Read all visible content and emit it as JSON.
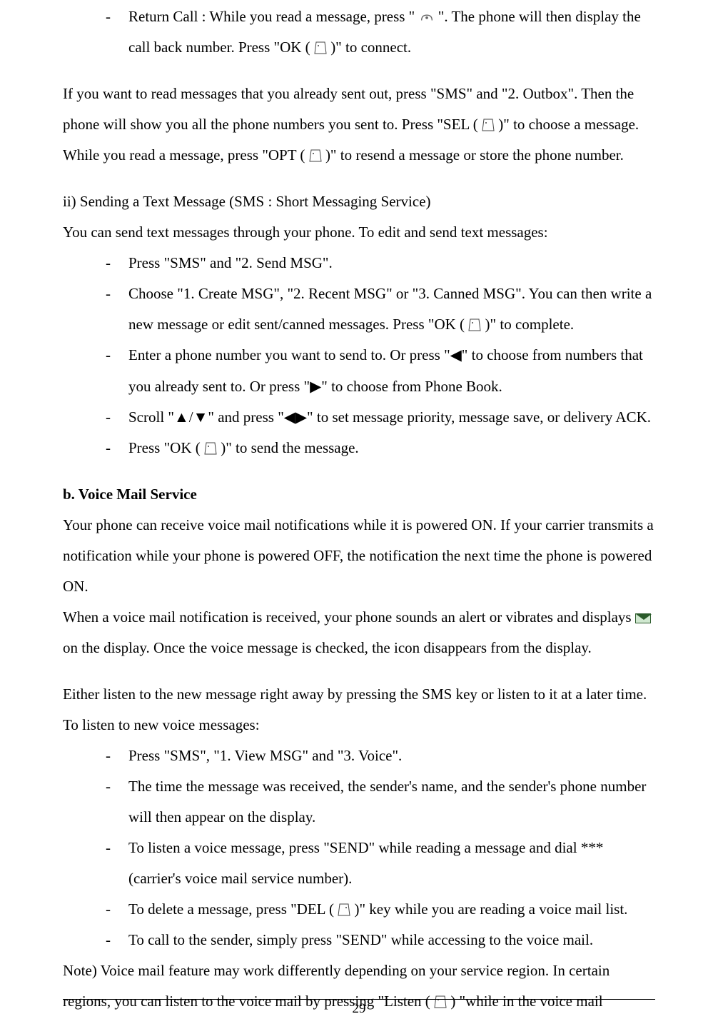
{
  "top_bullet": {
    "pre": "Return Call : While you read a message, press \" ",
    "post_icon1": " \". The phone will then display the ",
    "line2_pre": "call back number. Press \"OK (",
    "line2_post": ")\" to connect."
  },
  "outbox_para": {
    "l1_pre": "If you want to read messages that you already sent out, press \"SMS\" and \"2. Outbox\". Then the ",
    "l2_pre": "phone will show you all the phone numbers you sent to. Press \"SEL (",
    "l2_post": ")\" to choose a message. ",
    "l3_pre": "While you read a message, press \"OPT (",
    "l3_post": ")\" to resend a message or store the phone number."
  },
  "section_ii": {
    "title": "ii)   Sending a Text Message (SMS : Short Messaging Service)",
    "intro": "You can send text messages through your phone.    To edit and send text messages:",
    "b1": "Press \"SMS\" and \"2. Send MSG\".",
    "b2_l1": "Choose \"1. Create MSG\", \"2. Recent MSG\" or \"3. Canned MSG\". You can then write a ",
    "b2_l2_pre": "new message or edit sent/canned messages. Press \"OK (",
    "b2_l2_post": ")\" to complete.",
    "b3_l1": "Enter a phone number you want to send to. Or press \"◀\" to choose from numbers that ",
    "b3_l2": "you already sent to. Or press \"▶\" to choose from Phone Book.",
    "b4_l1": "Scroll \"▲/▼\" and press \"◀▶\" to set message priority, message save, or delivery ",
    "b4_l2": "ACK.",
    "b5_pre": "Press \"OK (",
    "b5_post": ")\" to send the message."
  },
  "voice_mail": {
    "heading": "b. Voice Mail Service",
    "p1_l1": "Your phone can receive voice mail notifications while it is powered ON.    If your carrier ",
    "p1_l2": "transmits a notification while your phone is powered OFF, the notification the next time the ",
    "p1_l3": "phone is powered ON.",
    "p2_l1": "When a voice mail notification is received, your phone sounds an alert or vibrates and displays ",
    "p2_l2_post": " on the display. Once the voice message is checked, the icon disappears from the display.",
    "p3_l1": "Either listen to the new message right away by pressing the SMS key or listen to it at a later ",
    "p3_l2": "time.    To listen to new voice messages:",
    "b1": "Press \"SMS\", \"1. View MSG\" and \"3. Voice\".",
    "b2_l1": "The time the message was received, the sender's name, and the sender's phone number ",
    "b2_l2": "will then appear on the display.",
    "b3_l1": "To listen a voice message, press \"SEND\" while reading a message and dial *** ",
    "b3_l2": "(carrier's voice mail service number).",
    "b4_pre": "To delete a message, press \"DEL (",
    "b4_post": ")\" key while you are reading a voice mail list.",
    "b5": "To call to the sender, simply press \"SEND\" while accessing to the voice mail.",
    "note_l1": "Note) Voice mail feature may work differently depending on your service region. In certain ",
    "note_l2_pre": "regions, you can listen to the voice mail by pressing \"Listen (",
    "note_l2_post": ") \"while in the voice mail"
  },
  "page_number": "29"
}
